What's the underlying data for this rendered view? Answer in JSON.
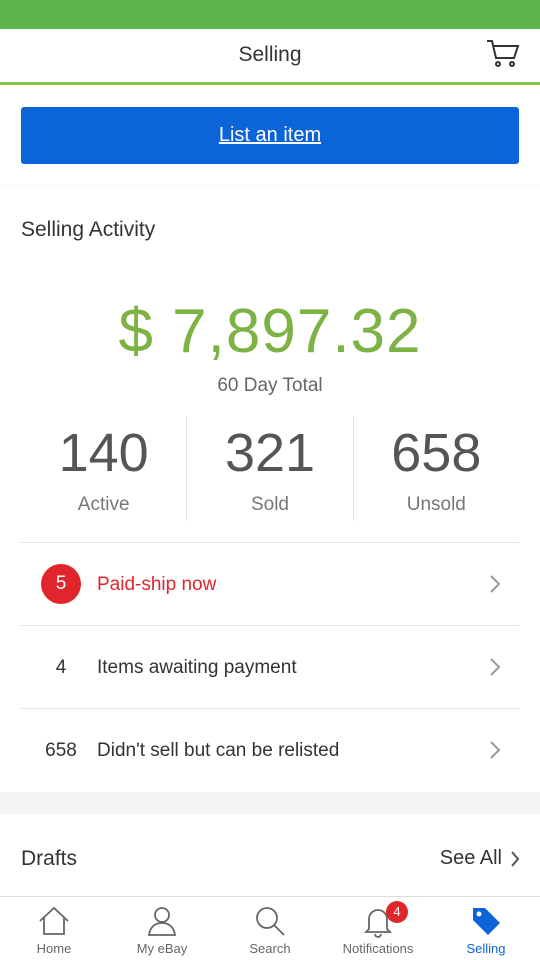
{
  "header": {
    "title": "Selling",
    "cart_icon": "cart-icon"
  },
  "list_item": {
    "label": "List an item",
    "color": "#0b64d8"
  },
  "activity": {
    "title": "Selling Activity",
    "total_amount": "$ 7,897.32",
    "total_label": "60 Day Total",
    "stats": [
      {
        "value": "140",
        "label": "Active"
      },
      {
        "value": "321",
        "label": "Sold"
      },
      {
        "value": "658",
        "label": "Unsold"
      }
    ],
    "rows": [
      {
        "count": "5",
        "label": "Paid-ship now",
        "alert": true,
        "badge_color": "#e0252d"
      },
      {
        "count": "4",
        "label": "Items awaiting payment",
        "alert": false
      },
      {
        "count": "658",
        "label": "Didn't sell but can be relisted",
        "alert": false
      }
    ]
  },
  "drafts": {
    "title": "Drafts",
    "see_all": "See All"
  },
  "tabbar": {
    "tabs": [
      {
        "label": "Home",
        "icon": "home-icon"
      },
      {
        "label": "My eBay",
        "icon": "person-icon"
      },
      {
        "label": "Search",
        "icon": "search-icon"
      },
      {
        "label": "Notifications",
        "icon": "bell-icon",
        "badge": "4"
      },
      {
        "label": "Selling",
        "icon": "tag-icon",
        "active": true
      }
    ],
    "active_color": "#0b64d8"
  },
  "colors": {
    "status_bar": "#5fb44c",
    "total_amount": "#7db244",
    "alert": "#e0252d"
  }
}
